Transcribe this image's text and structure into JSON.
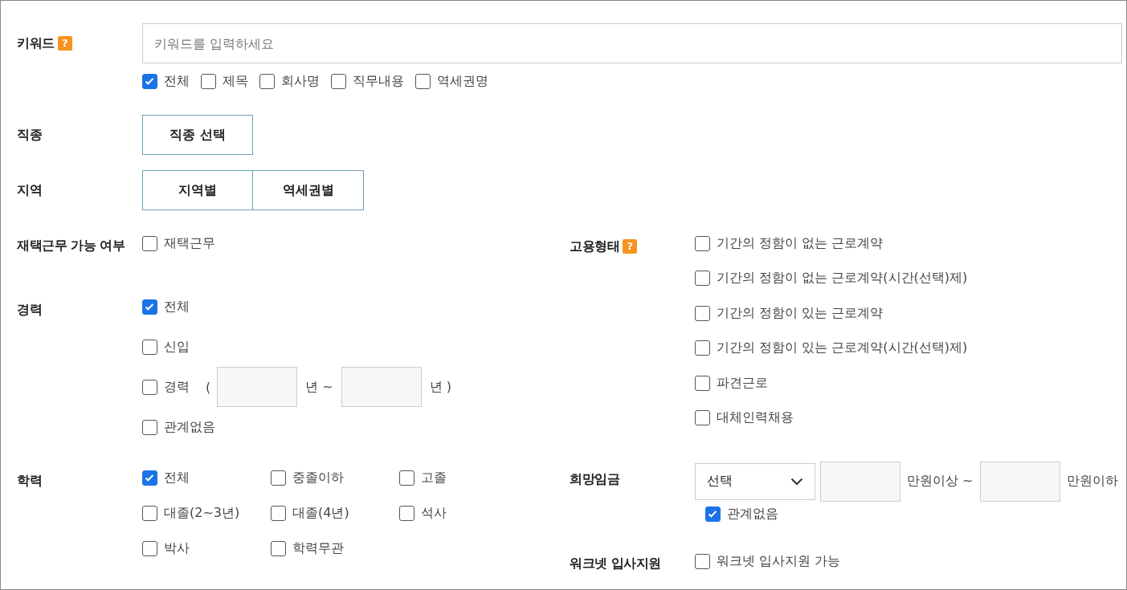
{
  "keyword": {
    "label": "키워드",
    "help": "?",
    "placeholder": "키워드를 입력하세요",
    "scopes": [
      {
        "label": "전체",
        "checked": true
      },
      {
        "label": "제목",
        "checked": false
      },
      {
        "label": "회사명",
        "checked": false
      },
      {
        "label": "직무내용",
        "checked": false
      },
      {
        "label": "역세권명",
        "checked": false
      }
    ]
  },
  "job_type": {
    "label": "직종",
    "button": "직종 선택"
  },
  "region": {
    "label": "지역",
    "buttons": [
      "지역별",
      "역세권별"
    ]
  },
  "remote": {
    "label": "재택근무 가능 여부",
    "options": [
      {
        "label": "재택근무",
        "checked": false
      }
    ]
  },
  "career": {
    "label": "경력",
    "options": [
      {
        "kind": "plain",
        "label": "전체",
        "checked": true
      },
      {
        "kind": "plain",
        "label": "신입",
        "checked": false
      },
      {
        "kind": "range",
        "label": "경력",
        "open": "(",
        "from_unit": "년 ~",
        "to_unit": "년 )",
        "checked": false
      },
      {
        "kind": "plain",
        "label": "관계없음",
        "checked": false
      }
    ]
  },
  "education": {
    "label": "학력",
    "options": [
      {
        "label": "전체",
        "checked": true
      },
      {
        "label": "중졸이하",
        "checked": false
      },
      {
        "label": "고졸",
        "checked": false
      },
      {
        "label": "대졸(2~3년)",
        "checked": false
      },
      {
        "label": "대졸(4년)",
        "checked": false
      },
      {
        "label": "석사",
        "checked": false
      },
      {
        "label": "박사",
        "checked": false
      },
      {
        "label": "학력무관",
        "checked": false
      }
    ]
  },
  "employment": {
    "label": "고용형태",
    "help": "?",
    "options": [
      {
        "label": "기간의 정함이 없는 근로계약",
        "checked": false
      },
      {
        "label": "기간의 정함이 없는 근로계약(시간(선택)제)",
        "checked": false
      },
      {
        "label": "기간의 정함이 있는 근로계약",
        "checked": false
      },
      {
        "label": "기간의 정함이 있는 근로계약(시간(선택)제)",
        "checked": false
      },
      {
        "label": "파견근로",
        "checked": false
      },
      {
        "label": "대체인력채용",
        "checked": false
      }
    ]
  },
  "salary": {
    "label": "희망임금",
    "select": "선택",
    "from_unit": "만원이상 ~",
    "to_unit": "만원이하",
    "any": {
      "label": "관계없음",
      "checked": true
    }
  },
  "worknet": {
    "label": "워크넷 입사지원",
    "options": [
      {
        "label": "워크넷 입사지원 가능",
        "checked": false
      }
    ]
  }
}
